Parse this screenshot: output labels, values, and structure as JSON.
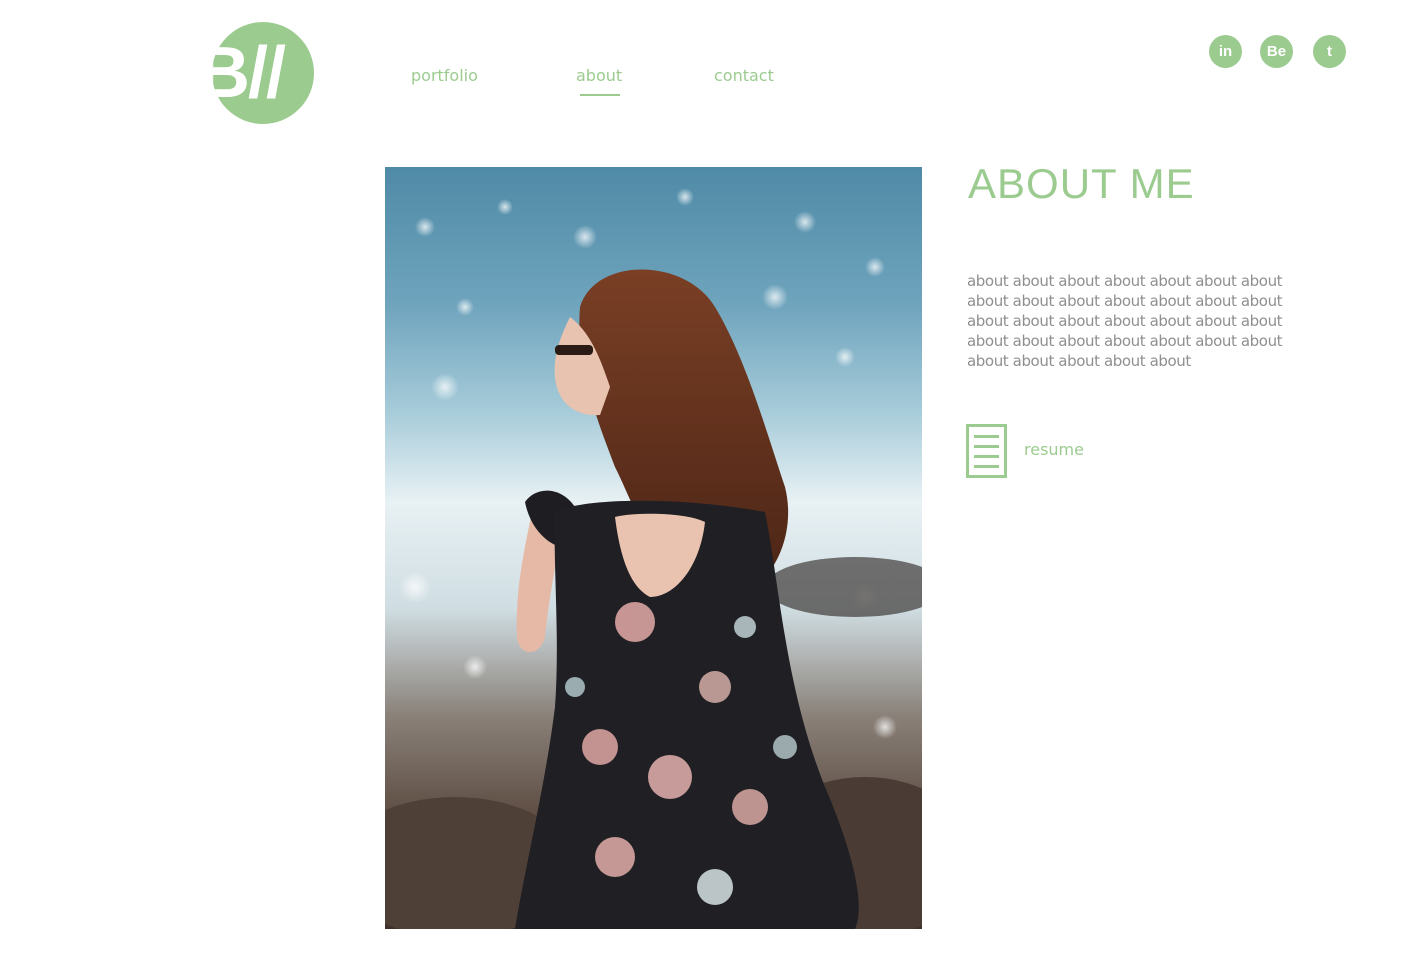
{
  "logo": {
    "text": "B//"
  },
  "nav": {
    "items": [
      {
        "label": "portfolio"
      },
      {
        "label": "about",
        "active": true
      },
      {
        "label": "contact"
      }
    ]
  },
  "social": [
    {
      "label": "in",
      "icon": "linkedin-icon"
    },
    {
      "label": "Be",
      "icon": "behance-icon"
    },
    {
      "label": "t",
      "icon": "tumblr-icon"
    }
  ],
  "about": {
    "title": "ABOUT ME",
    "body": "about about about about about about about about about about about about about about about about about about about about about about about about about about about about about about about about about"
  },
  "resume": {
    "label": "resume",
    "icon": "document-icon"
  },
  "colors": {
    "accent": "#9ccb90",
    "body_text": "#8f8f8f",
    "background": "#ffffff"
  }
}
